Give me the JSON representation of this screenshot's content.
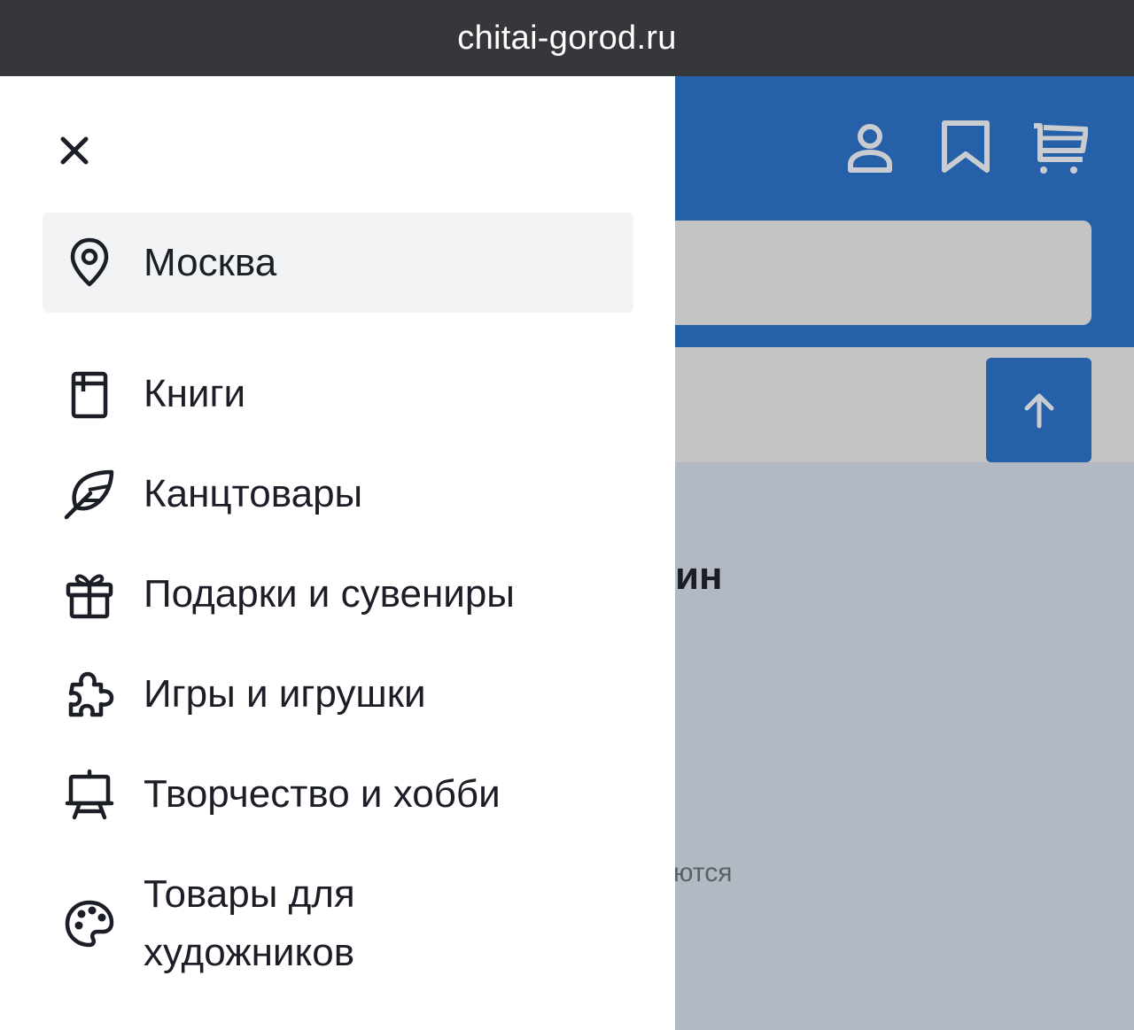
{
  "browser": {
    "url": "chitai-gorod.ru"
  },
  "drawer": {
    "city": "Москва",
    "menu": [
      {
        "label": "Книги",
        "icon": "book-icon"
      },
      {
        "label": "Канцтовары",
        "icon": "feather-icon"
      },
      {
        "label": "Подарки и сувениры",
        "icon": "gift-icon"
      },
      {
        "label": "Игры и игрушки",
        "icon": "puzzle-icon"
      },
      {
        "label": "Творчество и хобби",
        "icon": "easel-icon"
      },
      {
        "label": "Товары для художников",
        "icon": "palette-icon"
      }
    ]
  },
  "background": {
    "heading_fragment": "ин",
    "note_fragment": "ются"
  },
  "colors": {
    "brand_blue": "#2560a8",
    "overlay": "#b3b9c2",
    "text": "#1b1e26"
  }
}
